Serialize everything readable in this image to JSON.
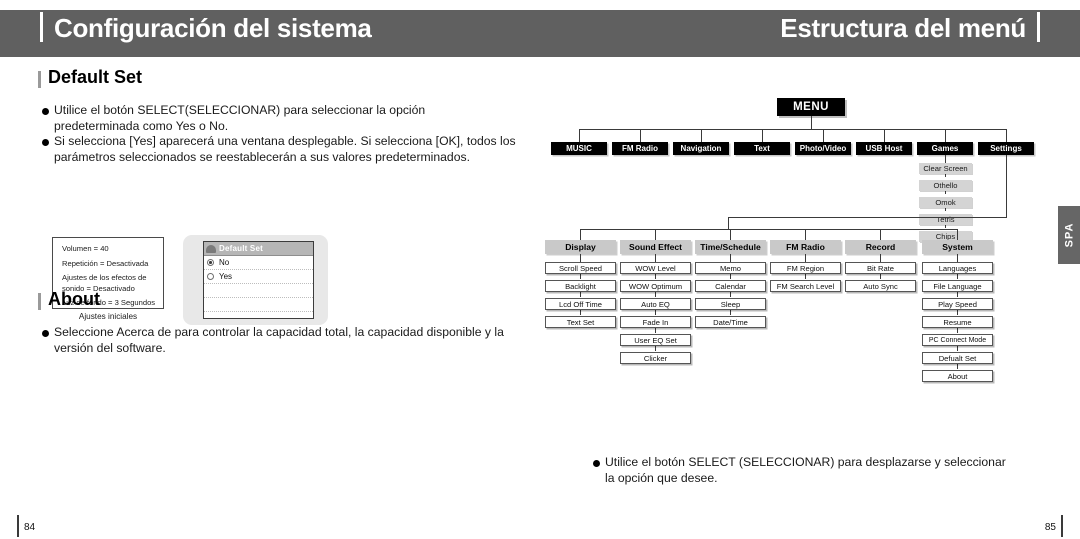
{
  "header": {
    "left_title": "Configuración del sistema",
    "right_title": "Estructura del menú",
    "band_color": "#606060"
  },
  "side_tab": {
    "label": "SPA"
  },
  "left_page": {
    "sections": [
      {
        "heading": "Default Set",
        "bullets": [
          "Utilice el botón SELECT(SELECCIONAR) para seleccionar la opción predeterminada como Yes o No.",
          "Si selecciona [Yes] aparecerá una ventana desplegable. Si selecciona [OK], todos los parámetros seleccionados se reestablecerán a sus valores predeterminados."
        ]
      },
      {
        "heading": "About",
        "bullets": [
          "Seleccione Acerca de para controlar la capacidad total, la capacidad disponible y la versión del software."
        ]
      }
    ],
    "initial_settings_box": {
      "lines": [
        "Volumen = 40",
        "Repetición = Desactivada",
        "Ajustes de los  efectos de sonido = Desactivado",
        "Luz de fondo = 3 Segundos"
      ],
      "caption": "Ajustes iniciales"
    },
    "device_screen": {
      "title": "Default Set",
      "title_icon": "folder-icon",
      "options": [
        {
          "label": "No",
          "selected": true
        },
        {
          "label": "Yes",
          "selected": false
        }
      ],
      "empty_rows": 4
    },
    "page_number": "84"
  },
  "right_page": {
    "tree": {
      "root": "MENU",
      "top_level": [
        "MUSIC",
        "FM Radio",
        "Navigation",
        "Text",
        "Photo/Video",
        "USB Host",
        "Games",
        "Settings"
      ],
      "games_children": [
        "Clear Screen",
        "Othello",
        "Omok",
        "Tetris",
        "Chips"
      ],
      "settings_categories": [
        {
          "label": "Display",
          "items": [
            "Scroll Speed",
            "Backlight",
            "Lcd Off Time",
            "Text Set"
          ]
        },
        {
          "label": "Sound Effect",
          "items": [
            "WOW Level",
            "WOW Optimum",
            "Auto EQ",
            "Fade In",
            "User EQ Set",
            "Clicker"
          ]
        },
        {
          "label": "Time/Schedule",
          "items": [
            "Memo",
            "Calendar",
            "Sleep",
            "Date/Time"
          ]
        },
        {
          "label": "FM Radio",
          "items": [
            "FM Region",
            "FM Search Level"
          ]
        },
        {
          "label": "Record",
          "items": [
            "Bit Rate",
            "Auto Sync"
          ]
        },
        {
          "label": "System",
          "items": [
            "Languages",
            "File Language",
            "Play Speed",
            "Resume",
            "PC Connect Mode",
            "Defualt Set",
            "About"
          ]
        }
      ]
    },
    "note_bullet": "Utilice el botón SELECT (SELECCIONAR) para desplazarse y seleccionar la opción que desee.",
    "page_number": "85"
  }
}
